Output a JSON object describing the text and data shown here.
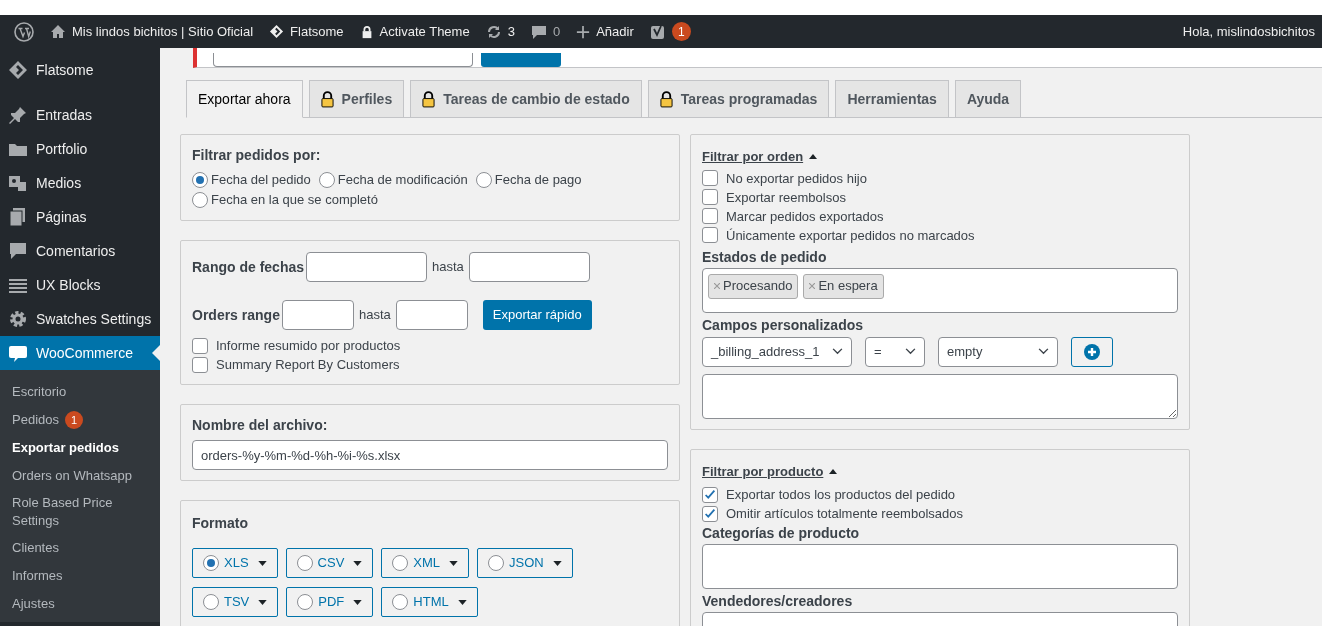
{
  "admin_bar": {
    "site": "Mis lindos bichitos | Sitio Oficial",
    "theme": "Flatsome",
    "activate": "Activate Theme",
    "updates": "3",
    "comments": "0",
    "add": "Añadir",
    "seo_badge": "1",
    "greeting": "Hola, mislindosbichitos"
  },
  "sidebar": {
    "items": [
      {
        "label": "Flatsome",
        "selected": false
      },
      {
        "label": "Entradas",
        "selected": false
      },
      {
        "label": "Portfolio",
        "selected": false
      },
      {
        "label": "Medios",
        "selected": false
      },
      {
        "label": "Páginas",
        "selected": false
      },
      {
        "label": "Comentarios",
        "selected": false
      },
      {
        "label": "UX Blocks",
        "selected": false
      },
      {
        "label": "Swatches Settings",
        "selected": false
      },
      {
        "label": "WooCommerce",
        "selected": true,
        "children": [
          {
            "label": "Escritorio",
            "selected": false
          },
          {
            "label": "Pedidos",
            "badge": "1",
            "selected": false
          },
          {
            "label": "Exportar pedidos",
            "selected": true
          },
          {
            "label": "Orders on Whatsapp",
            "selected": false
          },
          {
            "label": "Role Based Price Settings",
            "selected": false
          },
          {
            "label": "Clientes",
            "selected": false
          },
          {
            "label": "Informes",
            "selected": false
          },
          {
            "label": "Ajustes",
            "selected": false
          }
        ]
      }
    ]
  },
  "tabs": [
    {
      "label": "Exportar ahora",
      "locked": false,
      "selected": true
    },
    {
      "label": "Perfiles",
      "locked": true,
      "selected": false
    },
    {
      "label": "Tareas de cambio de estado",
      "locked": true,
      "selected": false
    },
    {
      "label": "Tareas programadas",
      "locked": true,
      "selected": false
    },
    {
      "label": "Herramientas",
      "locked": false,
      "selected": false
    },
    {
      "label": "Ayuda",
      "locked": false,
      "selected": false
    }
  ],
  "filter_orders_by": {
    "title": "Filtrar pedidos por:",
    "options": [
      {
        "label": "Fecha del pedido",
        "selected": true
      },
      {
        "label": "Fecha de modificación",
        "selected": false
      },
      {
        "label": "Fecha de pago",
        "selected": false
      },
      {
        "label": "Fecha en la que se completó",
        "selected": false
      }
    ]
  },
  "ranges": {
    "date_label": "Rango de fechas",
    "date_to": "hasta",
    "orders_label": "Orders range",
    "orders_to": "hasta",
    "quick_export": "Exportar rápido",
    "checks": [
      {
        "label": "Informe resumido por productos",
        "checked": false
      },
      {
        "label": "Summary Report By Customers",
        "checked": false
      }
    ]
  },
  "file_name": {
    "label": "Nombre del archivo:",
    "value": "orders-%y-%m-%d-%h-%i-%s.xlsx"
  },
  "format": {
    "title": "Formato",
    "options": [
      {
        "label": "XLS",
        "selected": true
      },
      {
        "label": "CSV",
        "selected": false
      },
      {
        "label": "XML",
        "selected": false
      },
      {
        "label": "JSON",
        "selected": false
      },
      {
        "label": "TSV",
        "selected": false
      },
      {
        "label": "PDF",
        "selected": false
      },
      {
        "label": "HTML",
        "selected": false
      }
    ]
  },
  "order_filter": {
    "title": "Filtrar por orden",
    "checks": [
      {
        "label": "No exportar pedidos hijo",
        "checked": false
      },
      {
        "label": "Exportar reembolsos",
        "checked": false
      },
      {
        "label": "Marcar pedidos exportados",
        "checked": false
      },
      {
        "label": "Únicamente exportar pedidos no marcados",
        "checked": false
      }
    ],
    "statuses_label": "Estados de pedido",
    "statuses": [
      "Procesando",
      "En espera"
    ],
    "custom_fields_label": "Campos personalizados",
    "field": "_billing_address_1",
    "operator": "=",
    "value": "empty"
  },
  "product_filter": {
    "title": "Filtrar por producto",
    "checks": [
      {
        "label": "Exportar todos los productos del pedido",
        "checked": true
      },
      {
        "label": "Omitir artículos totalmente reembolsados",
        "checked": true
      }
    ],
    "categories_label": "Categorías de producto",
    "vendors_label": "Vendedores/creadores"
  }
}
